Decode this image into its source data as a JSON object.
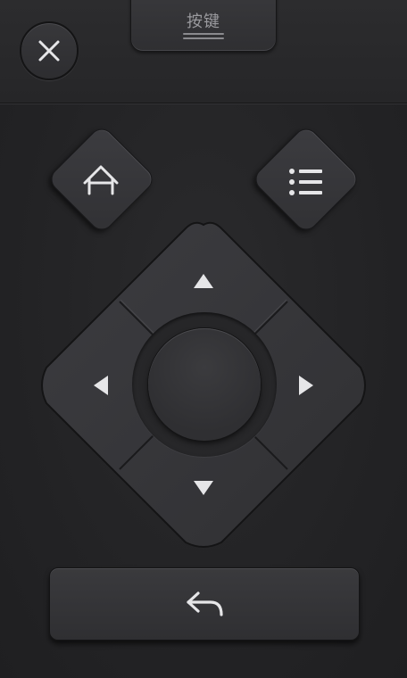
{
  "header": {
    "tab_label": "按键"
  },
  "icons": {
    "close": "close-icon",
    "home": "home-icon",
    "menu": "menu-list-icon",
    "up": "arrow-up-icon",
    "down": "arrow-down-icon",
    "left": "arrow-left-icon",
    "right": "arrow-right-icon",
    "back": "back-arrow-icon"
  },
  "colors": {
    "background": "#242426",
    "button_face": "#36363a",
    "icon": "#e6e6e8"
  }
}
